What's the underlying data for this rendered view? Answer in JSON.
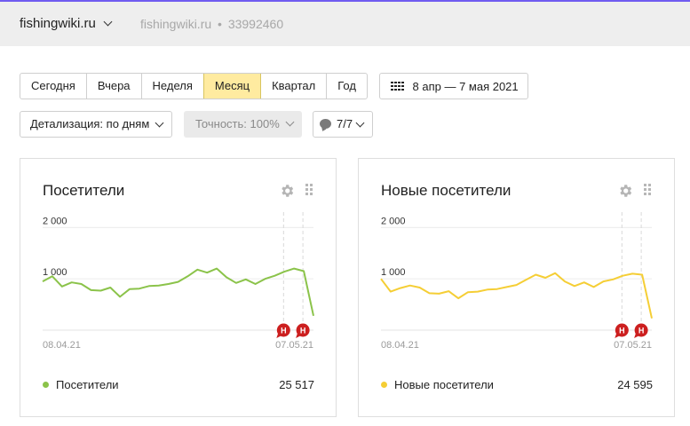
{
  "header": {
    "site": "fishingwiki.ru",
    "meta_site": "fishingwiki.ru",
    "meta_separator": "•",
    "counter_id": "33992460"
  },
  "periods": [
    "Сегодня",
    "Вчера",
    "Неделя",
    "Месяц",
    "Квартал",
    "Год"
  ],
  "active_period": "Месяц",
  "date_range": "8 апр — 7 мая 2021",
  "detail_label": "Детализация: по дням",
  "accuracy_label": "Точность: 100%",
  "comments_label": "7/7",
  "colors": {
    "accent_top": "#6f5cf0",
    "active_period_bg": "#ffeba0",
    "series_green": "#8bc34a",
    "series_yellow": "#f5ce35",
    "marker_red": "#cc1f1f"
  },
  "cards": [
    {
      "title": "Посетители",
      "legend_label": "Посетители",
      "total": "25 517",
      "color": "#8bc34a"
    },
    {
      "title": "Новые посетители",
      "legend_label": "Новые посетители",
      "total": "24 595",
      "color": "#f5ce35"
    }
  ],
  "chart_data": [
    {
      "type": "line",
      "title": "Посетители",
      "x_start_label": "08.04.21",
      "x_end_label": "07.05.21",
      "y_ticks": [
        "2 000",
        "1 000"
      ],
      "ylim": [
        0,
        2300
      ],
      "grid": "horizontal",
      "annotation_marker": "Н",
      "annotation_indices": [
        25,
        27
      ],
      "series": [
        {
          "name": "Посетители",
          "values": [
            950,
            1050,
            850,
            930,
            900,
            780,
            770,
            830,
            650,
            800,
            810,
            860,
            870,
            900,
            940,
            1050,
            1180,
            1120,
            1200,
            1030,
            920,
            990,
            900,
            1000,
            1060,
            1140,
            1200,
            1150,
            280
          ]
        }
      ]
    },
    {
      "type": "line",
      "title": "Новые посетители",
      "x_start_label": "08.04.21",
      "x_end_label": "07.05.21",
      "y_ticks": [
        "2 000",
        "1 000"
      ],
      "ylim": [
        0,
        2300
      ],
      "grid": "horizontal",
      "annotation_marker": "Н",
      "annotation_indices": [
        25,
        27
      ],
      "series": [
        {
          "name": "Новые посетители",
          "values": [
            1000,
            750,
            820,
            870,
            830,
            720,
            710,
            760,
            620,
            740,
            750,
            790,
            800,
            840,
            880,
            980,
            1080,
            1020,
            1110,
            950,
            860,
            930,
            840,
            950,
            990,
            1060,
            1100,
            1080,
            230
          ]
        }
      ]
    }
  ]
}
